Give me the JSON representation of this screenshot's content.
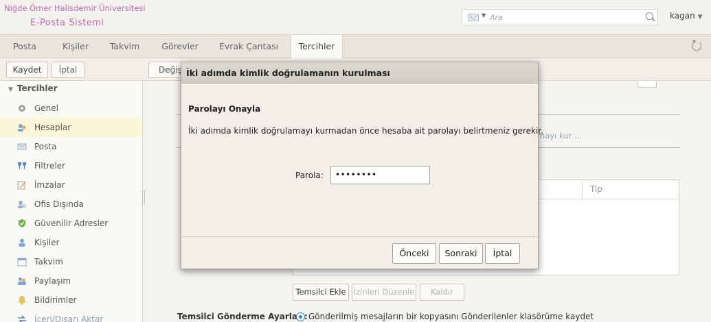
{
  "header": {
    "org_name": "Niğde Ömer Halisdemir Üniversitesi",
    "app_name": "E-Posta Sistemi",
    "search_placeholder": "Ara",
    "search_type_icon": "mail-icon",
    "user_name": "kagan"
  },
  "tabs": [
    {
      "label": "Posta"
    },
    {
      "label": "Kişiler"
    },
    {
      "label": "Takvim"
    },
    {
      "label": "Görevler"
    },
    {
      "label": "Evrak Çantası"
    },
    {
      "label": "Tercihler",
      "active": true
    }
  ],
  "toolbar": {
    "save_label": "Kaydet",
    "cancel_label": "İptal",
    "partial_change_label": "Değişik"
  },
  "sidebar": {
    "section_title": "Tercihler",
    "items": [
      {
        "label": "Genel",
        "icon": "gear-icon"
      },
      {
        "label": "Hesaplar",
        "icon": "accounts-icon",
        "selected": true
      },
      {
        "label": "Posta",
        "icon": "mail-icon"
      },
      {
        "label": "Filtreler",
        "icon": "filter-icon"
      },
      {
        "label": "İmzalar",
        "icon": "signature-icon"
      },
      {
        "label": "Ofis Dışında",
        "icon": "out-of-office-icon"
      },
      {
        "label": "Güvenilir Adresler",
        "icon": "shield-icon"
      },
      {
        "label": "Kişiler",
        "icon": "contact-icon"
      },
      {
        "label": "Takvim",
        "icon": "calendar-icon"
      },
      {
        "label": "Paylaşım",
        "icon": "sharing-icon"
      },
      {
        "label": "Bildirimler",
        "icon": "bell-icon"
      },
      {
        "label": "İçeri/Dışarı Aktar",
        "icon": "import-export-icon"
      }
    ]
  },
  "main": {
    "ghost_link_text": "amayı kur ...",
    "table_column_type": "Tip",
    "delegate_buttons": {
      "add": "Temsilci Ekle",
      "edit_permissions": "İzinleri Düzenle",
      "remove": "Kaldır"
    },
    "send_settings_label": "Temsilci Gönderme Ayarları:",
    "send_settings_option": "Gönderilmiş mesajların bir kopyasını Gönderilenler klasörüme kaydet"
  },
  "dialog": {
    "title": "İki adımda kimlik doğrulamanın kurulması",
    "subtitle": "Parolayı Onayla",
    "description": "İki adımda kimlik doğrulamayı kurmadan önce hesaba ait parolayı belirtmeniz gerekir.",
    "password_label": "Parola:",
    "password_value": "••••••••",
    "buttons": {
      "previous": "Önceki",
      "next": "Sonraki",
      "cancel": "İptal"
    }
  },
  "colors": {
    "logo": "#c06bb3",
    "selected_row": "#fdf6d8",
    "radio_accent": "#2f7fbf"
  }
}
